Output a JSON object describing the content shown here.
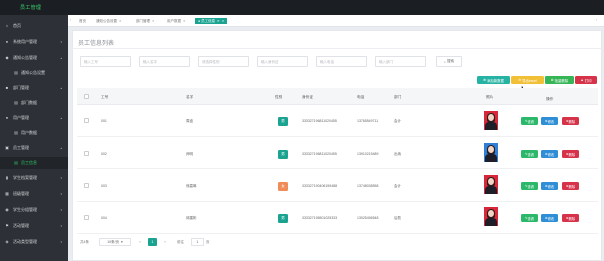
{
  "app": {
    "title": "员工管理"
  },
  "colors": {
    "accent": "#1aa391",
    "sidebar_bg": "#2d3137",
    "topbar_bg": "#1b1f24",
    "active_green": "#31c76a"
  },
  "sidebar": {
    "items": [
      {
        "label": "首页",
        "icon": "home-icon"
      },
      {
        "label": "系统用户管理",
        "icon": "user-icon"
      },
      {
        "label": "通知公告管理",
        "icon": "bell-icon"
      },
      {
        "label": "通知公告设置",
        "icon": "list-icon"
      },
      {
        "label": "部门管理",
        "icon": "folder-icon"
      },
      {
        "label": "部门数据",
        "icon": "list-icon"
      },
      {
        "label": "用户管理",
        "icon": "users-icon"
      },
      {
        "label": "用户数据",
        "icon": "list-icon"
      },
      {
        "label": "员工管理",
        "icon": "id-card-icon"
      },
      {
        "label": "员工信息",
        "icon": "list-icon"
      },
      {
        "label": "学生档案管理",
        "icon": "file-icon"
      },
      {
        "label": "班级管理",
        "icon": "grid-icon"
      },
      {
        "label": "学生分组管理",
        "icon": "group-icon"
      },
      {
        "label": "活动管理",
        "icon": "flag-icon"
      },
      {
        "label": "活动类型管理",
        "icon": "tag-icon"
      }
    ]
  },
  "tabs": [
    {
      "label": "首页"
    },
    {
      "label": "通知公告设置"
    },
    {
      "label": "部门管理"
    },
    {
      "label": "用户数据"
    },
    {
      "label": "员工信息"
    }
  ],
  "page": {
    "title": "员工信息列表"
  },
  "search": {
    "placeholders": [
      "输入工号",
      "输入名字",
      "请选择性别",
      "输入身份证",
      "输入电话",
      "输入部门"
    ],
    "button": "搜索"
  },
  "actions": {
    "add": "添加新数据",
    "export": "导出excel",
    "batch_delete": "批量删除",
    "print": "打印"
  },
  "table": {
    "headers": [
      "工号",
      "名字",
      "性别",
      "身份证",
      "电话",
      "部门",
      "照片",
      "操作"
    ],
    "rows": [
      {
        "id": "001",
        "name": "周迪",
        "sex": "男",
        "idcard": "333327196811020455",
        "phone": "13765549711",
        "dept": "会计"
      },
      {
        "id": "002",
        "name": "师明",
        "sex": "男",
        "idcard": "333327196811020455",
        "phone": "13910215489",
        "dept": "出纳"
      },
      {
        "id": "003",
        "name": "熊嘉琳",
        "sex": "女",
        "idcard": "333327190406159488",
        "phone": "13748038558",
        "dept": "会计"
      },
      {
        "id": "004",
        "name": "邱建彬",
        "sex": "男",
        "idcard": "333327196501025333",
        "phone": "13025496548",
        "dept": "后勤"
      }
    ],
    "row_buttons": {
      "view": "查看",
      "edit": "修改",
      "delete": "删除"
    }
  },
  "pagination": {
    "total_label": "共4条",
    "page_size": "10条/页",
    "current_page": "1",
    "goto_label": "前往",
    "goto_value": "1",
    "page_suffix": "页"
  }
}
